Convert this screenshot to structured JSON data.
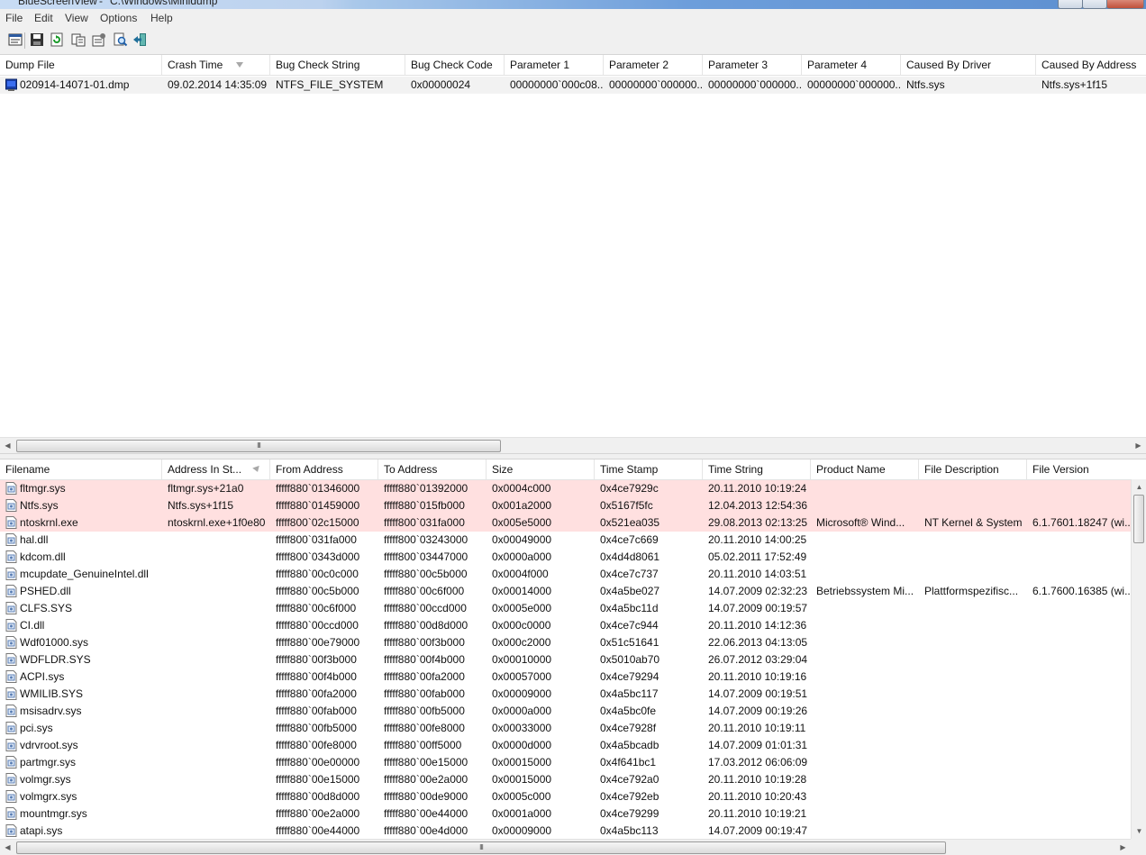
{
  "window": {
    "app_title": "BlueScreenView",
    "separator": "-",
    "path": "C:\\Windows\\Minidump"
  },
  "menu": [
    "File",
    "Edit",
    "View",
    "Options",
    "Help"
  ],
  "toolbar_icons": [
    "properties-icon",
    "save-icon",
    "refresh-icon",
    "copy-icon",
    "advanced-options-icon",
    "find-icon",
    "exit-icon"
  ],
  "top_table": {
    "columns": [
      "Dump File",
      "Crash Time",
      "Bug Check String",
      "Bug Check Code",
      "Parameter 1",
      "Parameter 2",
      "Parameter 3",
      "Parameter 4",
      "Caused By Driver",
      "Caused By Address"
    ],
    "rows": [
      {
        "icon": "dump-file-icon",
        "cells": [
          "020914-14071-01.dmp",
          "09.02.2014 14:35:09",
          "NTFS_FILE_SYSTEM",
          "0x00000024",
          "00000000`000c08...",
          "00000000`000000...",
          "00000000`000000...",
          "00000000`000000...",
          "Ntfs.sys",
          "Ntfs.sys+1f15"
        ]
      }
    ]
  },
  "bottom_table": {
    "columns": [
      "Filename",
      "Address In St...",
      "From Address",
      "To Address",
      "Size",
      "Time Stamp",
      "Time String",
      "Product Name",
      "File Description",
      "File Version"
    ],
    "highlight_color": "#ffe0e0",
    "rows": [
      {
        "highlight": true,
        "cells": [
          "fltmgr.sys",
          "fltmgr.sys+21a0",
          "fffff880`01346000",
          "fffff880`01392000",
          "0x0004c000",
          "0x4ce7929c",
          "20.11.2010 10:19:24",
          "",
          "",
          ""
        ]
      },
      {
        "highlight": true,
        "cells": [
          "Ntfs.sys",
          "Ntfs.sys+1f15",
          "fffff880`01459000",
          "fffff880`015fb000",
          "0x001a2000",
          "0x5167f5fc",
          "12.04.2013 12:54:36",
          "",
          "",
          ""
        ]
      },
      {
        "highlight": true,
        "cells": [
          "ntoskrnl.exe",
          "ntoskrnl.exe+1f0e80",
          "fffff800`02c15000",
          "fffff800`031fa000",
          "0x005e5000",
          "0x521ea035",
          "29.08.2013 02:13:25",
          "Microsoft® Wind...",
          "NT Kernel & System",
          "6.1.7601.18247 (wi..."
        ]
      },
      {
        "highlight": false,
        "cells": [
          "hal.dll",
          "",
          "fffff800`031fa000",
          "fffff800`03243000",
          "0x00049000",
          "0x4ce7c669",
          "20.11.2010 14:00:25",
          "",
          "",
          ""
        ]
      },
      {
        "highlight": false,
        "cells": [
          "kdcom.dll",
          "",
          "fffff800`0343d000",
          "fffff800`03447000",
          "0x0000a000",
          "0x4d4d8061",
          "05.02.2011 17:52:49",
          "",
          "",
          ""
        ]
      },
      {
        "highlight": false,
        "cells": [
          "mcupdate_GenuineIntel.dll",
          "",
          "fffff880`00c0c000",
          "fffff880`00c5b000",
          "0x0004f000",
          "0x4ce7c737",
          "20.11.2010 14:03:51",
          "",
          "",
          ""
        ]
      },
      {
        "highlight": false,
        "cells": [
          "PSHED.dll",
          "",
          "fffff880`00c5b000",
          "fffff880`00c6f000",
          "0x00014000",
          "0x4a5be027",
          "14.07.2009 02:32:23",
          "Betriebssystem Mi...",
          "Plattformspezifisc...",
          "6.1.7600.16385 (wi..."
        ]
      },
      {
        "highlight": false,
        "cells": [
          "CLFS.SYS",
          "",
          "fffff880`00c6f000",
          "fffff880`00ccd000",
          "0x0005e000",
          "0x4a5bc11d",
          "14.07.2009 00:19:57",
          "",
          "",
          ""
        ]
      },
      {
        "highlight": false,
        "cells": [
          "CI.dll",
          "",
          "fffff880`00ccd000",
          "fffff880`00d8d000",
          "0x000c0000",
          "0x4ce7c944",
          "20.11.2010 14:12:36",
          "",
          "",
          ""
        ]
      },
      {
        "highlight": false,
        "cells": [
          "Wdf01000.sys",
          "",
          "fffff880`00e79000",
          "fffff880`00f3b000",
          "0x000c2000",
          "0x51c51641",
          "22.06.2013 04:13:05",
          "",
          "",
          ""
        ]
      },
      {
        "highlight": false,
        "cells": [
          "WDFLDR.SYS",
          "",
          "fffff880`00f3b000",
          "fffff880`00f4b000",
          "0x00010000",
          "0x5010ab70",
          "26.07.2012 03:29:04",
          "",
          "",
          ""
        ]
      },
      {
        "highlight": false,
        "cells": [
          "ACPI.sys",
          "",
          "fffff880`00f4b000",
          "fffff880`00fa2000",
          "0x00057000",
          "0x4ce79294",
          "20.11.2010 10:19:16",
          "",
          "",
          ""
        ]
      },
      {
        "highlight": false,
        "cells": [
          "WMILIB.SYS",
          "",
          "fffff880`00fa2000",
          "fffff880`00fab000",
          "0x00009000",
          "0x4a5bc117",
          "14.07.2009 00:19:51",
          "",
          "",
          ""
        ]
      },
      {
        "highlight": false,
        "cells": [
          "msisadrv.sys",
          "",
          "fffff880`00fab000",
          "fffff880`00fb5000",
          "0x0000a000",
          "0x4a5bc0fe",
          "14.07.2009 00:19:26",
          "",
          "",
          ""
        ]
      },
      {
        "highlight": false,
        "cells": [
          "pci.sys",
          "",
          "fffff880`00fb5000",
          "fffff880`00fe8000",
          "0x00033000",
          "0x4ce7928f",
          "20.11.2010 10:19:11",
          "",
          "",
          ""
        ]
      },
      {
        "highlight": false,
        "cells": [
          "vdrvroot.sys",
          "",
          "fffff880`00fe8000",
          "fffff880`00ff5000",
          "0x0000d000",
          "0x4a5bcadb",
          "14.07.2009 01:01:31",
          "",
          "",
          ""
        ]
      },
      {
        "highlight": false,
        "cells": [
          "partmgr.sys",
          "",
          "fffff880`00e00000",
          "fffff880`00e15000",
          "0x00015000",
          "0x4f641bc1",
          "17.03.2012 06:06:09",
          "",
          "",
          ""
        ]
      },
      {
        "highlight": false,
        "cells": [
          "volmgr.sys",
          "",
          "fffff880`00e15000",
          "fffff880`00e2a000",
          "0x00015000",
          "0x4ce792a0",
          "20.11.2010 10:19:28",
          "",
          "",
          ""
        ]
      },
      {
        "highlight": false,
        "cells": [
          "volmgrx.sys",
          "",
          "fffff880`00d8d000",
          "fffff880`00de9000",
          "0x0005c000",
          "0x4ce792eb",
          "20.11.2010 10:20:43",
          "",
          "",
          ""
        ]
      },
      {
        "highlight": false,
        "cells": [
          "mountmgr.sys",
          "",
          "fffff880`00e2a000",
          "fffff880`00e44000",
          "0x0001a000",
          "0x4ce79299",
          "20.11.2010 10:19:21",
          "",
          "",
          ""
        ]
      },
      {
        "highlight": false,
        "cells": [
          "atapi.sys",
          "",
          "fffff880`00e44000",
          "fffff880`00e4d000",
          "0x00009000",
          "0x4a5bc113",
          "14.07.2009 00:19:47",
          "",
          "",
          ""
        ]
      }
    ]
  },
  "scrollbars": {
    "top_h_grip": "III",
    "bottom_h_grip": "III",
    "bottom_v_grip": "="
  }
}
